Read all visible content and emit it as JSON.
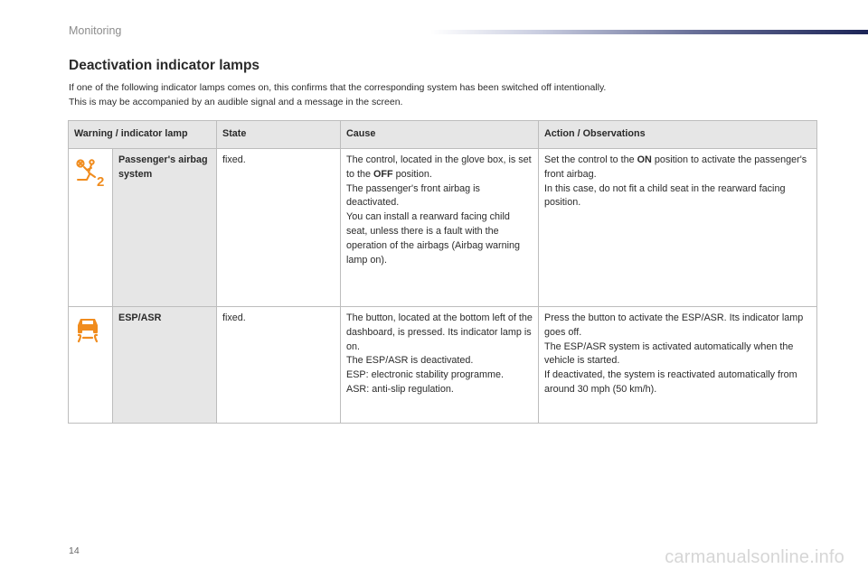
{
  "header": {
    "title": "Monitoring"
  },
  "section": {
    "title": "Deactivation indicator lamps",
    "intro": [
      "If one of the following indicator lamps comes on, this confirms that the corresponding system has been switched off intentionally.",
      "This is may be accompanied by an audible signal and a message in the screen."
    ]
  },
  "table": {
    "headers": [
      "Warning / indicator lamp",
      "State",
      "Cause",
      "Action / Observations"
    ],
    "rows": [
      {
        "icon": "airbag-off-icon",
        "name": "Passenger's airbag system",
        "state": "fixed.",
        "cause": {
          "pre": "The control, located in the glove box, is set to the ",
          "bold": "OFF",
          "post": " position.",
          "lines": [
            "The passenger's front airbag is deactivated.",
            "You can install a rearward facing child seat, unless there is a fault with the operation of the airbags (Airbag warning lamp on)."
          ]
        },
        "action": {
          "pre": "Set the control to the ",
          "bold": "ON",
          "post": " position to activate the passenger's front airbag.",
          "lines": [
            "In this case, do not fit a child seat in the rearward facing position."
          ]
        }
      },
      {
        "icon": "esp-off-icon",
        "name": "ESP/ASR",
        "state": "fixed.",
        "cause": {
          "lines": [
            "The button, located at the bottom left of the dashboard, is pressed. Its indicator lamp is on.",
            "The ESP/ASR is deactivated.",
            "ESP: electronic stability programme.",
            "ASR: anti-slip regulation."
          ]
        },
        "action": {
          "lines": [
            "Press the button to activate the ESP/ASR. Its indicator lamp goes off.",
            "The ESP/ASR system is activated automatically when the vehicle is started.",
            "If deactivated, the system is reactivated automatically from around 30 mph (50 km/h)."
          ]
        }
      }
    ]
  },
  "footer": {
    "page_number": "14",
    "watermark": "carmanualsonline.info"
  },
  "colors": {
    "icon_orange": "#f08c1e",
    "header_fill": "#e6e6e6",
    "bar_dark": "#1c2457"
  }
}
